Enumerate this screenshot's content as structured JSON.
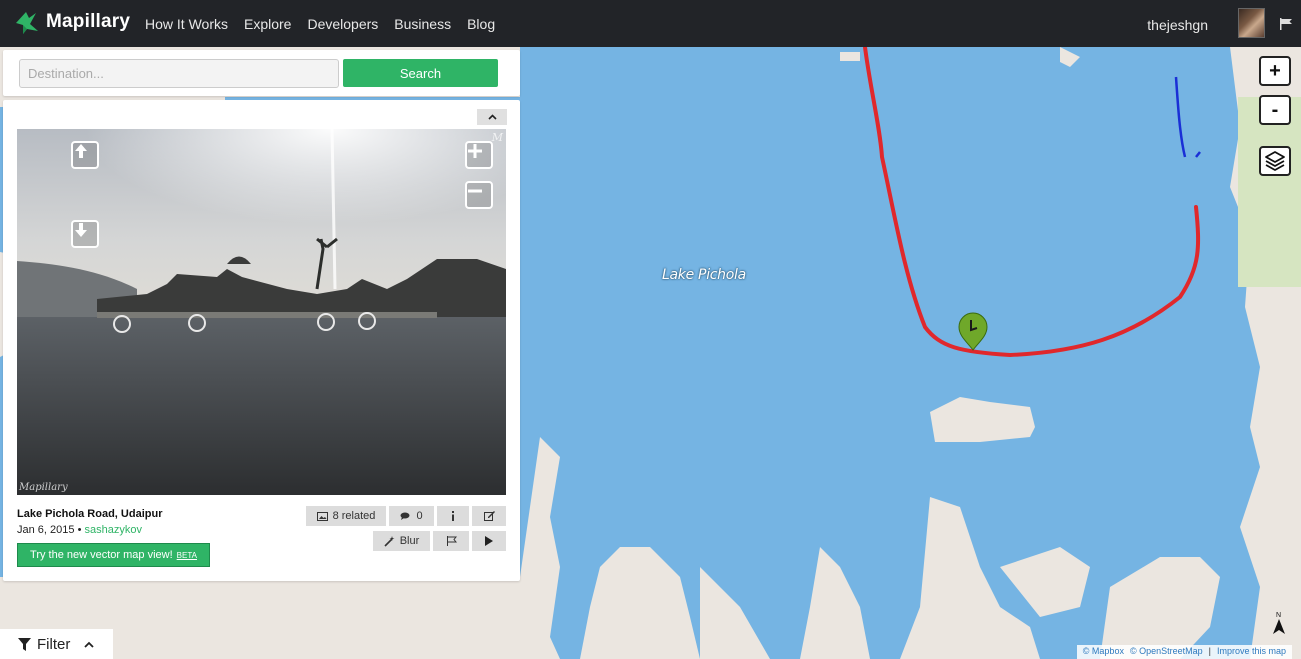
{
  "topbar": {
    "brand": "Mapillary",
    "nav": [
      "How It Works",
      "Explore",
      "Developers",
      "Business",
      "Blog"
    ],
    "username": "thejeshgn"
  },
  "search": {
    "placeholder": "Destination...",
    "button_label": "Search"
  },
  "image": {
    "location": "Lake Pichola Road, Udaipur",
    "date": "Jan 6, 2015",
    "separator": "•",
    "author": "sashazykov",
    "watermark": "Mapillary",
    "mini_logo": "M",
    "related_label": "8 related",
    "comments_count": "0",
    "blur_label": "Blur",
    "vector_cta": "Try the new vector map view!",
    "vector_badge": "BETA"
  },
  "map": {
    "lake_label": "Lake Pichola",
    "zoom_in": "+",
    "zoom_out": "-",
    "colors": {
      "water": "#75b4e3",
      "land": "#ebe6e0",
      "route": "#e0282c",
      "route_alt": "#1a2fd6",
      "park": "#d6e5c1",
      "marker": "#6fa82a"
    }
  },
  "filter": {
    "label": "Filter"
  },
  "attribution": {
    "mapbox": "© Mapbox",
    "osm": "© OpenStreetMap",
    "separator": "|",
    "improve": "Improve this map"
  },
  "north_label": "N"
}
